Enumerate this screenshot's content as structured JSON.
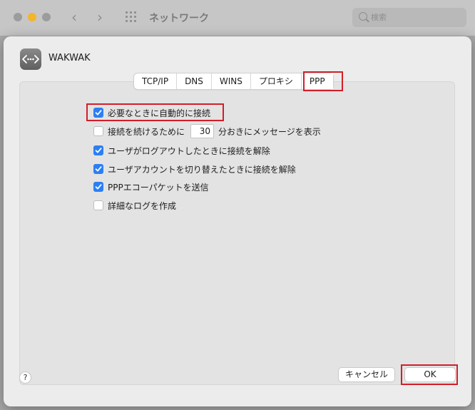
{
  "background_window": {
    "title": "ネットワーク",
    "search_placeholder": "検索"
  },
  "service": {
    "name": "WAKWAK"
  },
  "tabs": [
    {
      "label": "TCP/IP"
    },
    {
      "label": "DNS"
    },
    {
      "label": "WINS"
    },
    {
      "label": "プロキシ"
    },
    {
      "label": "PPP"
    }
  ],
  "options": {
    "connect_on_demand": {
      "label": "必要なときに自動的に接続",
      "checked": true
    },
    "keepalive": {
      "prefix": "接続を続けるために",
      "value": "30",
      "suffix": "分おきにメッセージを表示",
      "checked": false
    },
    "disconnect_logout": {
      "label": "ユーザがログアウトしたときに接続を解除",
      "checked": true
    },
    "disconnect_switch": {
      "label": "ユーザアカウントを切り替えたときに接続を解除",
      "checked": true
    },
    "echo_packets": {
      "label": "PPPエコーパケットを送信",
      "checked": true
    },
    "verbose_log": {
      "label": "詳細なログを作成",
      "checked": false
    }
  },
  "buttons": {
    "help": "?",
    "cancel": "キャンセル",
    "ok": "OK"
  },
  "colors": {
    "accent": "#2b7ff5",
    "highlight": "#d11f2a",
    "window_min": "#f3b52c"
  }
}
